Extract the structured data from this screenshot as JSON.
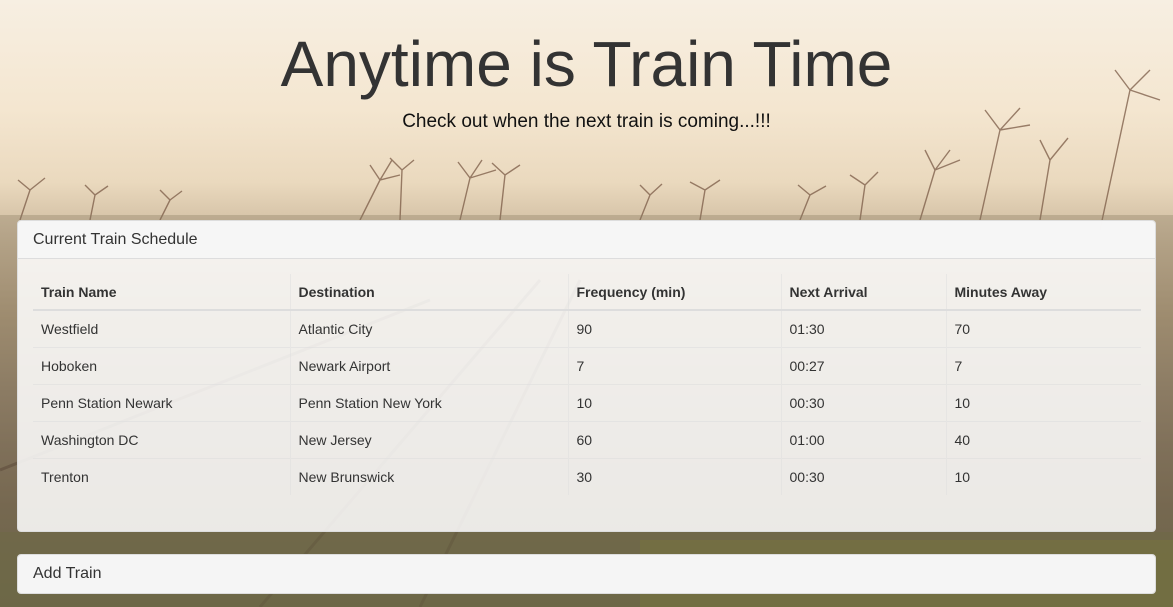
{
  "header": {
    "title": "Anytime is Train Time",
    "subtitle": "Check out when the next train is coming...!!!"
  },
  "schedule": {
    "heading": "Current Train Schedule",
    "columns": [
      "Train Name",
      "Destination",
      "Frequency (min)",
      "Next Arrival",
      "Minutes Away"
    ],
    "rows": [
      [
        "Westfield",
        "Atlantic City",
        "90",
        "01:30",
        "70"
      ],
      [
        "Hoboken",
        "Newark Airport",
        "7",
        "00:27",
        "7"
      ],
      [
        "Penn Station Newark",
        "Penn Station New York",
        "10",
        "00:30",
        "10"
      ],
      [
        "Washington DC",
        "New Jersey",
        "60",
        "01:00",
        "40"
      ],
      [
        "Trenton",
        "New Brunswick",
        "30",
        "00:30",
        "10"
      ]
    ]
  },
  "add_train": {
    "heading": "Add Train"
  },
  "colors": {
    "title": "#333333",
    "panel_bg": "#ffffff",
    "panel_border": "#dddddd"
  }
}
